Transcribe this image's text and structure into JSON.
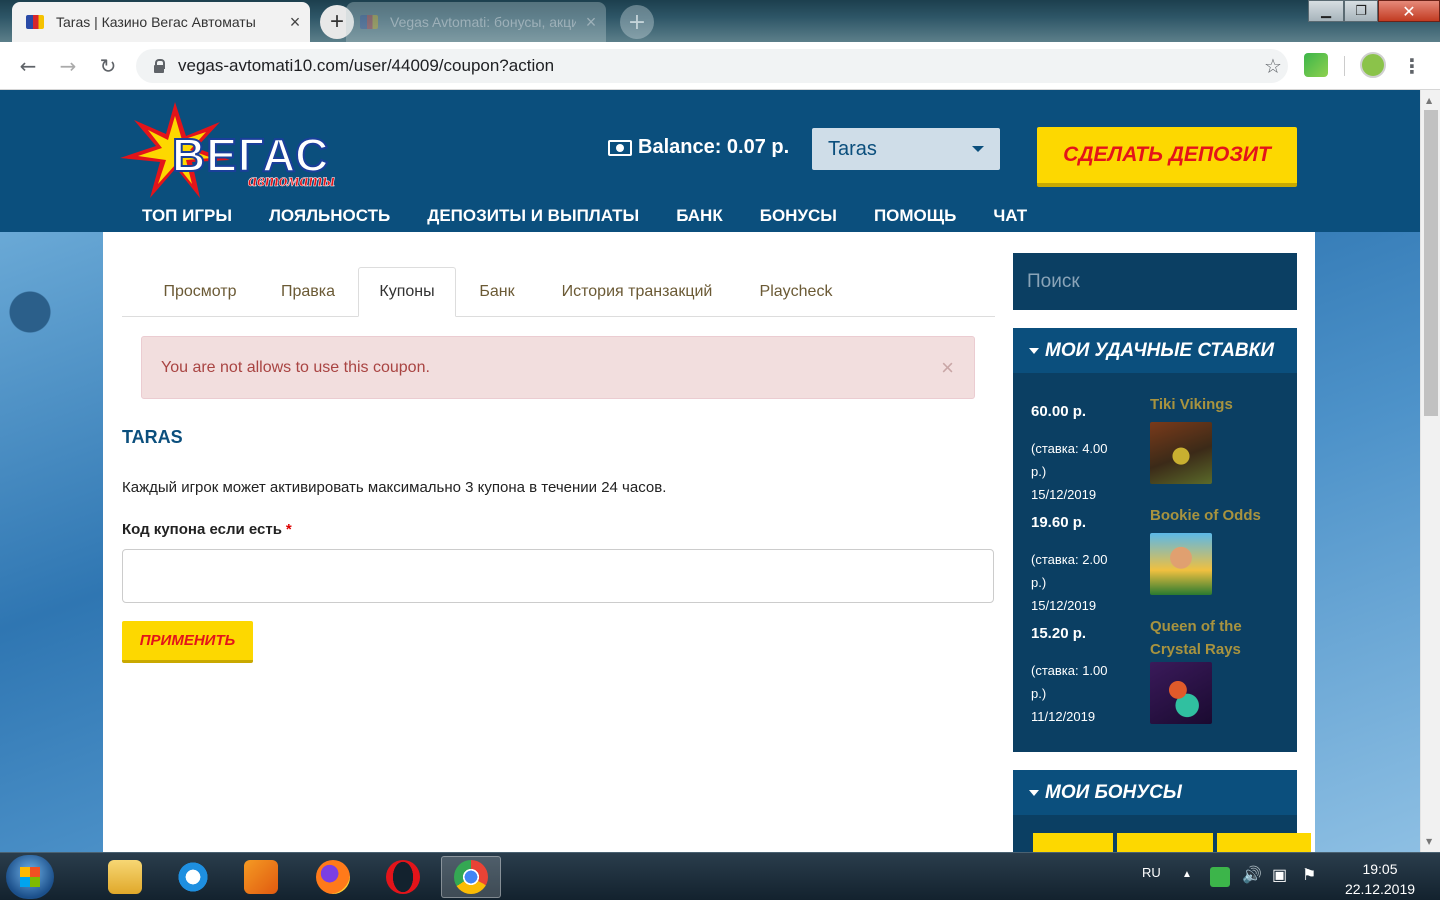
{
  "browser": {
    "tabs": [
      {
        "title": "Taras | Казино Вегас Автоматы",
        "active": true
      },
      {
        "title": "Vegas Avtomati: бонусы, акции",
        "active": false
      }
    ],
    "new_tab_icon": "+",
    "close_icon": "×",
    "window_controls": {
      "minimize": "▁",
      "maximize": "❐",
      "close": "✕"
    },
    "url": "vegas-avtomati10.com/user/44009/coupon?action",
    "back": "←",
    "forward": "→",
    "reload": "↻",
    "bookmark": "☆",
    "menu": "⋮"
  },
  "site": {
    "balance_label": "Balance: 0.07 р.",
    "user_select": "Taras",
    "deposit_button": "СДЕЛАТЬ ДЕПОЗИТ",
    "nav": [
      "ТОП ИГРЫ",
      "ЛОЯЛЬНОСТЬ",
      "ДЕПОЗИТЫ И ВЫПЛАТЫ",
      "БАНК",
      "БОНУСЫ",
      "ПОМОЩЬ",
      "ЧАТ"
    ],
    "logo_text": "ВЕГАС",
    "logo_sub": "автоматы",
    "colors": {
      "header": "#0b4f7d",
      "accent_yellow": "#fdd800",
      "accent_red": "#e3141a"
    }
  },
  "page": {
    "tabs": [
      "Просмотр",
      "Правка",
      "Купоны",
      "Банк",
      "История транзакций",
      "Playcheck"
    ],
    "active_tab": "Купоны",
    "alert": "You are not allows to use this coupon.",
    "alert_close": "×",
    "heading": "TARAS",
    "info": "Каждый игрок может активировать максимально 3 купона в течении 24 часов.",
    "coupon_label": "Код купона если есть",
    "required_mark": "*",
    "coupon_value": "",
    "apply_button": "ПРИМЕНИТЬ"
  },
  "sidebar": {
    "search_placeholder": "Поиск",
    "bets_title": "МОИ УДАЧНЫЕ СТАВКИ",
    "bets": [
      {
        "amount": "60.00 р.",
        "stake": "(ставка: 4.00 р.)",
        "date": "15/12/2019",
        "game": "Tiki Vikings"
      },
      {
        "amount": "19.60 р.",
        "stake": "(ставка: 2.00 р.)",
        "date": "15/12/2019",
        "game": "Bookie of Odds"
      },
      {
        "amount": "15.20 р.",
        "stake": "(ставка: 1.00 р.)",
        "date": "11/12/2019",
        "game": "Queen of the Crystal Rays"
      }
    ],
    "bonus_title": "МОИ БОНУСЫ"
  },
  "taskbar": {
    "lang": "RU",
    "time": "19:05",
    "date": "22.12.2019"
  }
}
